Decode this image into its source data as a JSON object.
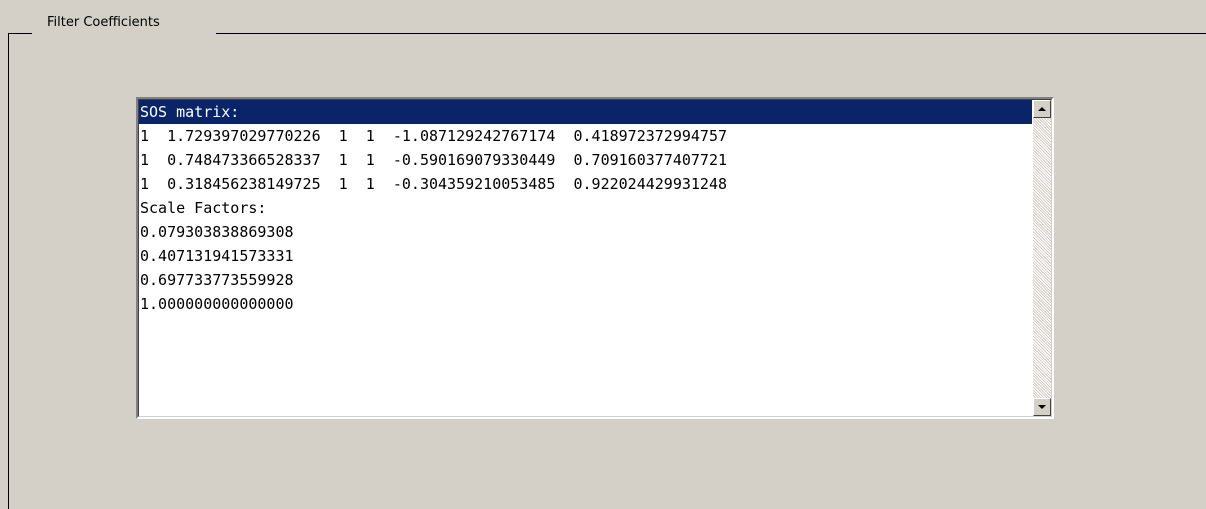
{
  "group": {
    "title": "Filter Coefficients"
  },
  "coefficients_list": {
    "selected_index": 0,
    "lines": [
      "SOS matrix:",
      "1  1.729397029770226  1  1  -1.087129242767174  0.418972372994757",
      "1  0.748473366528337  1  1  -0.590169079330449  0.709160377407721",
      "1  0.318456238149725  1  1  -0.304359210053485  0.922024429931248",
      "Scale Factors:",
      "0.079303838869308",
      "0.407131941573331",
      "0.697733773559928",
      "1.000000000000000"
    ]
  },
  "icons": {
    "scroll_up": "scroll-up-arrow-icon",
    "scroll_down": "scroll-down-arrow-icon"
  },
  "colors": {
    "background": "#d4d0c8",
    "selection": "#0a246a",
    "selection_text": "#ffffff",
    "list_background": "#ffffff"
  }
}
